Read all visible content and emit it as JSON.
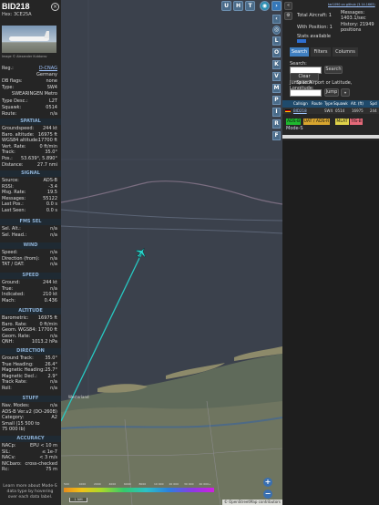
{
  "aircraft": {
    "callsign": "BID218",
    "hex_line": "Hex: 3CE25A",
    "close_label": "×",
    "photo_credit": "Image © Alexander Kutdorov",
    "reg_label": "Reg.:",
    "reg_value": "D-CNAG",
    "country_value": "Germany",
    "dbflags_label": "DB flags:",
    "dbflags_value": "none",
    "type_label": "Type:",
    "type_value": "SW4",
    "type_name": "SWEARINGEN Metro",
    "typedesc_label": "Type Desc.:",
    "typedesc_value": "L2T",
    "squawk_label": "Squawk:",
    "squawk_value": "0514",
    "route_label": "Route:",
    "route_value": "n/a"
  },
  "sections": {
    "spatial": "SPATIAL",
    "signal": "SIGNAL",
    "fms": "FMS SEL",
    "wind": "WIND",
    "speed": "SPEED",
    "altitude": "ALTITUDE",
    "direction": "DIRECTION",
    "stuff": "STUFF",
    "accuracy": "ACCURACY"
  },
  "spatial_rows": [
    {
      "k": "Groundspeed:",
      "v": "244 kt"
    },
    {
      "k": "Baro. altitude:",
      "v": "16975 ft"
    },
    {
      "k": "WGS84 altitude:",
      "v": "17700 ft"
    },
    {
      "k": "Vert. Rate:",
      "v": "0 ft/min"
    },
    {
      "k": "Track:",
      "v": "35.0°"
    },
    {
      "k": "Pos.:",
      "v": "53.639°, 5.890°"
    },
    {
      "k": "Distance:",
      "v": "27.7 nmi"
    }
  ],
  "signal_rows": [
    {
      "k": "Source:",
      "v": "ADS-B"
    },
    {
      "k": "RSSI:",
      "v": "-3.4"
    },
    {
      "k": "Msg. Rate:",
      "v": "19.5"
    },
    {
      "k": "Messages:",
      "v": "55122"
    },
    {
      "k": "Last Pos.:",
      "v": "0.0 s"
    },
    {
      "k": "Last Seen:",
      "v": "0.0 s"
    }
  ],
  "fms_rows": [
    {
      "k": "Sel. Alt.:",
      "v": "n/a"
    },
    {
      "k": "Sel. Head.:",
      "v": "n/a"
    }
  ],
  "wind_rows": [
    {
      "k": "Speed:",
      "v": "n/a"
    },
    {
      "k": "Direction (from):",
      "v": "n/a"
    },
    {
      "k": "TAT / OAT:",
      "v": "n/a"
    }
  ],
  "speed_rows": [
    {
      "k": "Ground:",
      "v": "244 kt"
    },
    {
      "k": "True:",
      "v": "n/a"
    },
    {
      "k": "Indicated:",
      "v": "210 kt"
    },
    {
      "k": "Mach:",
      "v": "0.436"
    }
  ],
  "altitude_rows": [
    {
      "k": "Barometric:",
      "v": "16975 ft"
    },
    {
      "k": "Baro. Rate:",
      "v": "0 ft/min"
    },
    {
      "k": "Geom. WGS84:",
      "v": "17700 ft"
    },
    {
      "k": "Geom. Rate:",
      "v": "n/a"
    },
    {
      "k": "QNH:",
      "v": "1013.2 hPa"
    }
  ],
  "direction_rows": [
    {
      "k": "Ground Track:",
      "v": "35.0°"
    },
    {
      "k": "True Heading:",
      "v": "26.4°"
    },
    {
      "k": "Magnetic Heading:",
      "v": "25.7°"
    },
    {
      "k": "Magnetic Decl.:",
      "v": "2.9°"
    },
    {
      "k": "Track Rate:",
      "v": "n/a"
    },
    {
      "k": "Roll:",
      "v": "n/a"
    }
  ],
  "stuff_rows": [
    {
      "k": "Nav. Modes:",
      "v": "n/a"
    },
    {
      "k": "ADS-B Ver.:",
      "v": "v2 (DO-260B)"
    },
    {
      "k": "Category:",
      "v": "A2"
    },
    {
      "k": "Small (15 500 to",
      "v": ""
    },
    {
      "k": "75 000 lb)",
      "v": ""
    }
  ],
  "accuracy_rows": [
    {
      "k": "NACp:",
      "v": "EPU < 10 m"
    },
    {
      "k": "SIL:",
      "v": "≤ 1e-7"
    },
    {
      "k": "NACv:",
      "v": "< 3 m/s"
    },
    {
      "k": "NICbaro:",
      "v": "cross-checked"
    },
    {
      "k": "Rc:",
      "v": "75 m"
    }
  ],
  "legend_note": "Learn more about Mode-S data type by hovering over each data label.",
  "map": {
    "top_buttons": [
      "U",
      "H",
      "T"
    ],
    "side_buttons": [
      "L",
      "O",
      "K",
      "V",
      "M",
      "P",
      "I",
      "R",
      "F"
    ],
    "zoom_in": "+",
    "zoom_out": "−",
    "scale_label": "1 NM",
    "osm_credit": "© OpenStreetMap contributors",
    "alt_labels": [
      "500",
      "1000",
      "2000",
      "4000",
      "6000",
      "8000",
      "10 000",
      "20 000",
      "30 000",
      "40 000+"
    ],
    "town_label": "Westerland"
  },
  "right": {
    "version_line": "tar1090 on github (3.14.1663)",
    "total_label": "Total Aircraft: 1",
    "messages_label": "Messages:",
    "messages_value": "1403.1/sec",
    "position_label": "With Position: 1",
    "history_label": "History: 21949",
    "history_sub": "positions",
    "stats_label": "Stats available",
    "tabs": [
      "Search",
      "Filters",
      "Columns"
    ],
    "search_heading": "Search:",
    "search_button": "Search",
    "clear_button": "Clear Search",
    "jump_heading": "Jump to Airport or Latitude, Longitude:",
    "jump_button": "Jump",
    "my_loc_button": "Clear",
    "table_headers": [
      "Callsign",
      "Route",
      "Type",
      "Squawk",
      "Alt. (ft)",
      "Spd"
    ],
    "table_row": {
      "flag": "",
      "callsign": "BID218",
      "route": "",
      "type": "SW4",
      "squawk": "0514",
      "alt": "16975",
      "spd": "244"
    },
    "source_pills": [
      {
        "label": "ADS-B",
        "color": "#1fb82f"
      },
      {
        "label": "UAT / ADS-R",
        "color": "#d8a52f"
      },
      {
        "label": "MLAT",
        "color": "#e0d24a"
      },
      {
        "label": "TIS-B",
        "color": "#e56a7a"
      }
    ],
    "modes_label": "Mode-S"
  }
}
